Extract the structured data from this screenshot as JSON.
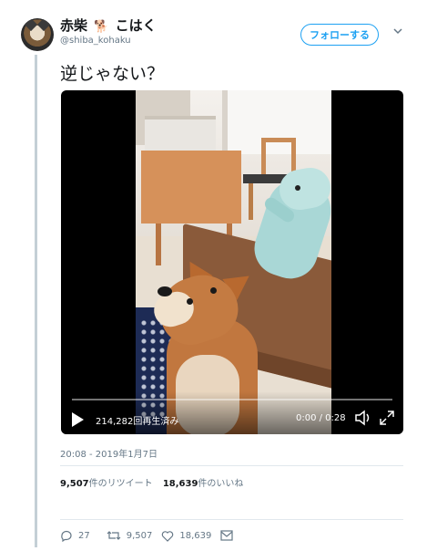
{
  "user": {
    "display_name_a": "赤柴",
    "emoji": "🐕",
    "display_name_b": "こはく",
    "handle": "@shiba_kohaku",
    "follow_label": "フォローする"
  },
  "tweet": {
    "text": "逆じゃない？",
    "timestamp": "20:08 - 2019年1月7日"
  },
  "video": {
    "view_count": "214,282回再生済み",
    "time": "0:00 / 0:28",
    "progress": 0
  },
  "stats": {
    "retweets_count": "9,507",
    "retweets_label": "件のリツイート",
    "likes_count": "18,639",
    "likes_label": "件のいいね"
  },
  "actions": {
    "reply_count": "27",
    "retweet_count": "9,507",
    "like_count": "18,639"
  },
  "icons": [
    "chevron-down-icon",
    "play-icon",
    "volume-icon",
    "fullscreen-icon",
    "reply-icon",
    "retweet-icon",
    "like-icon",
    "dm-icon"
  ],
  "colors": {
    "accent": "#1da1f2",
    "muted": "#657786",
    "text": "#14171a"
  }
}
